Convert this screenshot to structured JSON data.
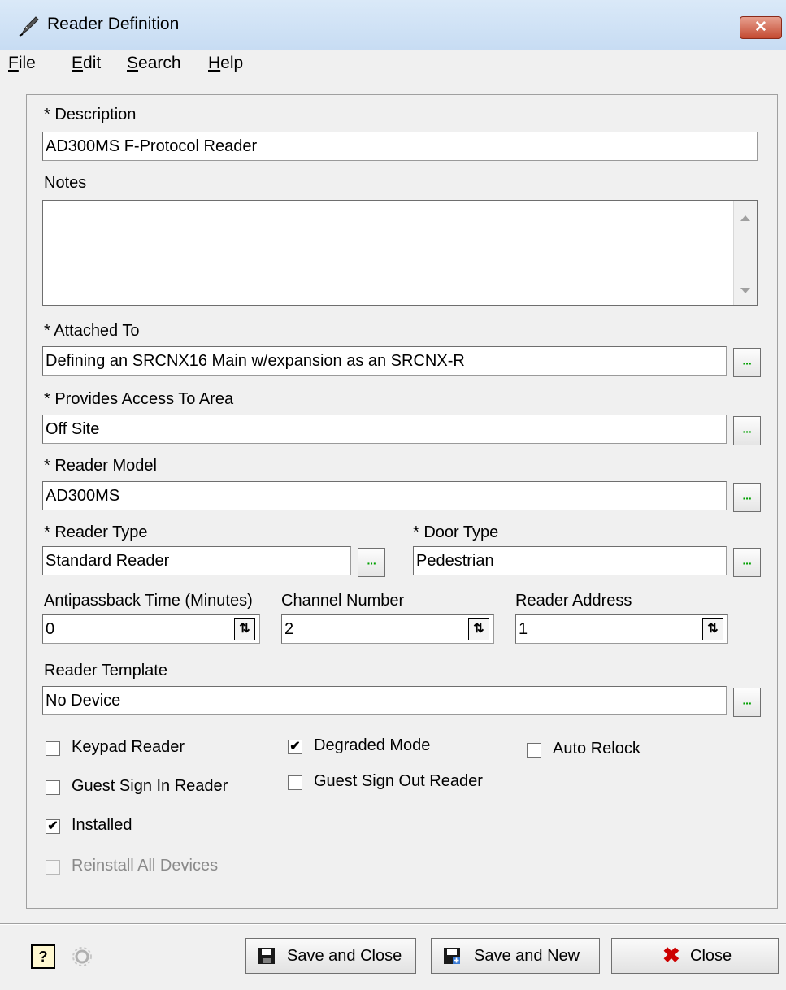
{
  "window": {
    "title": "Reader Definition",
    "close_glyph": "✕"
  },
  "menu": [
    "File",
    "Edit",
    "Search",
    "Help"
  ],
  "form": {
    "description_label": "* Description",
    "description_value": "AD300MS F-Protocol Reader",
    "notes_label": "Notes",
    "notes_value": "",
    "attached_label": "* Attached To",
    "attached_value": "Defining an SRCNX16 Main w/expansion as an SRCNX-R",
    "area_label": "* Provides Access To Area",
    "area_value": "Off Site",
    "model_label": "* Reader Model",
    "model_value": "AD300MS",
    "type_label": "* Reader Type",
    "type_value": "Standard Reader",
    "door_label": "* Door Type",
    "door_value": "Pedestrian",
    "apb_label": "Antipassback Time (Minutes)",
    "apb_value": "0",
    "channel_label": "Channel Number",
    "channel_value": "2",
    "address_label": "Reader Address",
    "address_value": "1",
    "template_label": "Reader Template",
    "template_value": "No Device",
    "ellipsis": "···",
    "spin_glyph": "⇅"
  },
  "checkboxes": {
    "keypad": {
      "label": "Keypad Reader",
      "checked": false
    },
    "degraded": {
      "label": "Degraded Mode",
      "checked": true
    },
    "autorelock": {
      "label": "Auto Relock",
      "checked": false
    },
    "guest_in": {
      "label": "Guest Sign In Reader",
      "checked": false
    },
    "guest_out": {
      "label": "Guest Sign Out Reader",
      "checked": false
    },
    "installed": {
      "label": "Installed",
      "checked": true
    },
    "reinstall": {
      "label": "Reinstall All Devices",
      "checked": false,
      "disabled": true
    }
  },
  "footer": {
    "help_glyph": "?",
    "save_close": "Save and Close",
    "save_new": "Save and New",
    "close": "Close",
    "close_glyph": "✖"
  },
  "colors": {
    "ellipsis_green": "#00a000",
    "close_red": "#cc0000",
    "title_close_red": "#c44a31"
  }
}
